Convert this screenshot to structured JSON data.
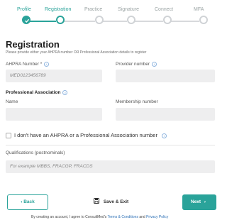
{
  "stepper": {
    "steps": [
      {
        "label": "Profile",
        "state": "done"
      },
      {
        "label": "Registration",
        "state": "active"
      },
      {
        "label": "Practice",
        "state": "pending"
      },
      {
        "label": "Signature",
        "state": "pending"
      },
      {
        "label": "Connect",
        "state": "pending"
      },
      {
        "label": "MFA",
        "state": "pending"
      }
    ],
    "accent_color": "#2aa39a"
  },
  "form": {
    "title": "Registration",
    "subtitle": "Please provide either your AHPRA number OR Professional Association details to register",
    "ahpra": {
      "label": "AHPRA Number *",
      "value": "MED0123456789"
    },
    "provider": {
      "label": "Provider number",
      "value": ""
    },
    "association": {
      "title": "Professional Association",
      "name_label": "Name",
      "membership_label": "Membership number"
    },
    "no_ahpra_checkbox": {
      "label": "I don't have an AHPRA or a Professional Association number",
      "checked": false
    },
    "qualifications": {
      "label": "Qualifications (postnominals)",
      "placeholder": "For example MBBS, FRACGP, FRACDS"
    }
  },
  "actions": {
    "back_label": "Back",
    "save_label": "Save & Exit",
    "next_label": "Next"
  },
  "footer": {
    "prefix": "By creating an account, I agree to ConsultMed's",
    "terms": "Terms & Conditions",
    "and": "and",
    "privacy": "Privacy Policy"
  }
}
